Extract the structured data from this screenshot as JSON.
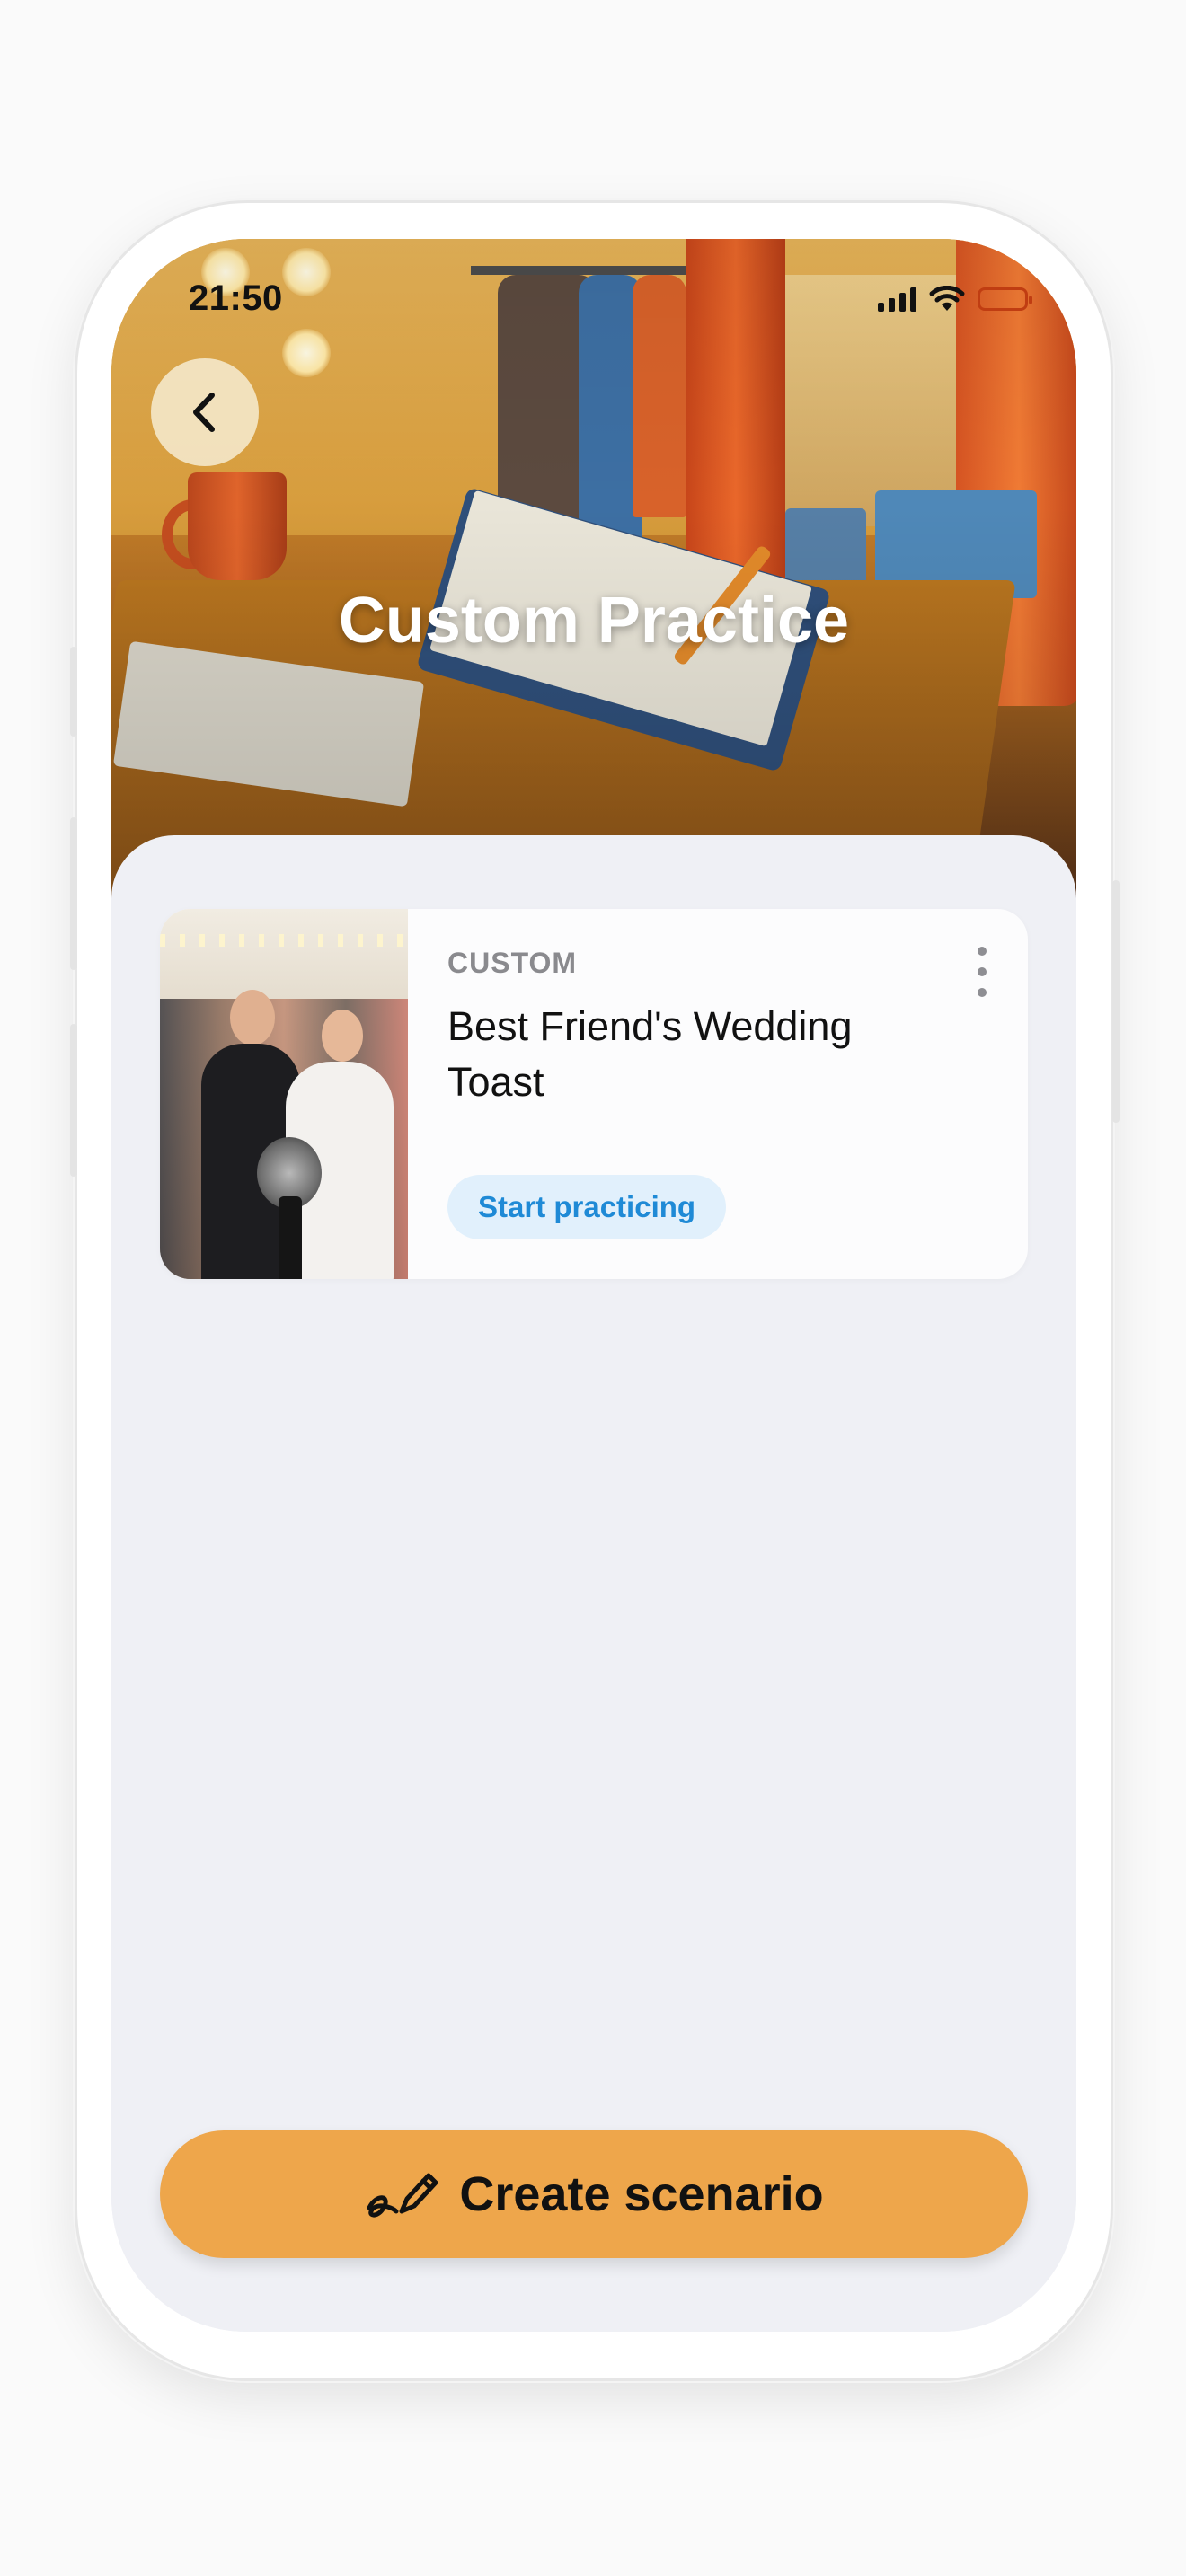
{
  "status_bar": {
    "time": "21:50"
  },
  "header": {
    "title": "Custom Practice",
    "back_icon": "chevron-left-icon"
  },
  "scenarios": [
    {
      "tag": "CUSTOM",
      "title": "Best Friend's Wedding Toast",
      "action_label": "Start practicing",
      "image": "wedding-toast-illustration",
      "menu_icon": "more-vertical-icon"
    }
  ],
  "footer": {
    "create_label": "Create scenario",
    "create_icon": "pen-scribble-icon"
  },
  "colors": {
    "accent": "#EEA64B",
    "screen_bg": "#EFF0F5",
    "action_text": "#1F8AD6",
    "action_bg": "#E1F0FC",
    "battery": "#C03D12"
  }
}
